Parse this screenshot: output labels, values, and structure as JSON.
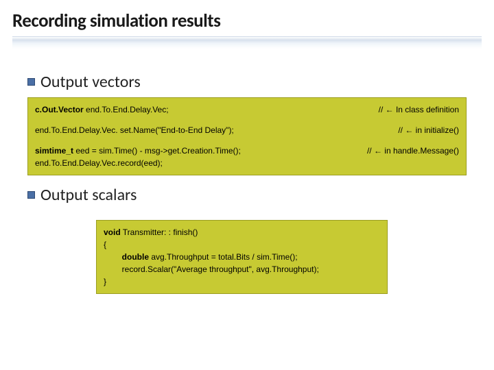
{
  "title": "Recording simulation results",
  "bullets": {
    "vectors": "Output vectors",
    "scalars": "Output scalars"
  },
  "code_vectors": {
    "line1_left_kw": "c.Out.Vector",
    "line1_left_rest": " end.To.End.Delay.Vec;",
    "line1_right": "// ← In class definition",
    "line2_left": "end.To.End.Delay.Vec. set.Name(\"End-to-End Delay\");",
    "line2_right": "// ← in initialize()",
    "line3_left_kw": "simtime_t",
    "line3_left_rest": " eed = sim.Time() - msg->get.Creation.Time();",
    "line3_right": "// ← in handle.Message()",
    "line4_left": "end.To.End.Delay.Vec.record(eed);"
  },
  "code_scalars": {
    "sig_kw1": "void",
    "sig_rest": " Transmitter: : finish()",
    "brace_open": "{",
    "body_kw": "double",
    "body_rest": " avg.Throughput = total.Bits / sim.Time();",
    "body_line2": "record.Scalar(\"Average throughput\", avg.Throughput);",
    "brace_close": "}"
  }
}
